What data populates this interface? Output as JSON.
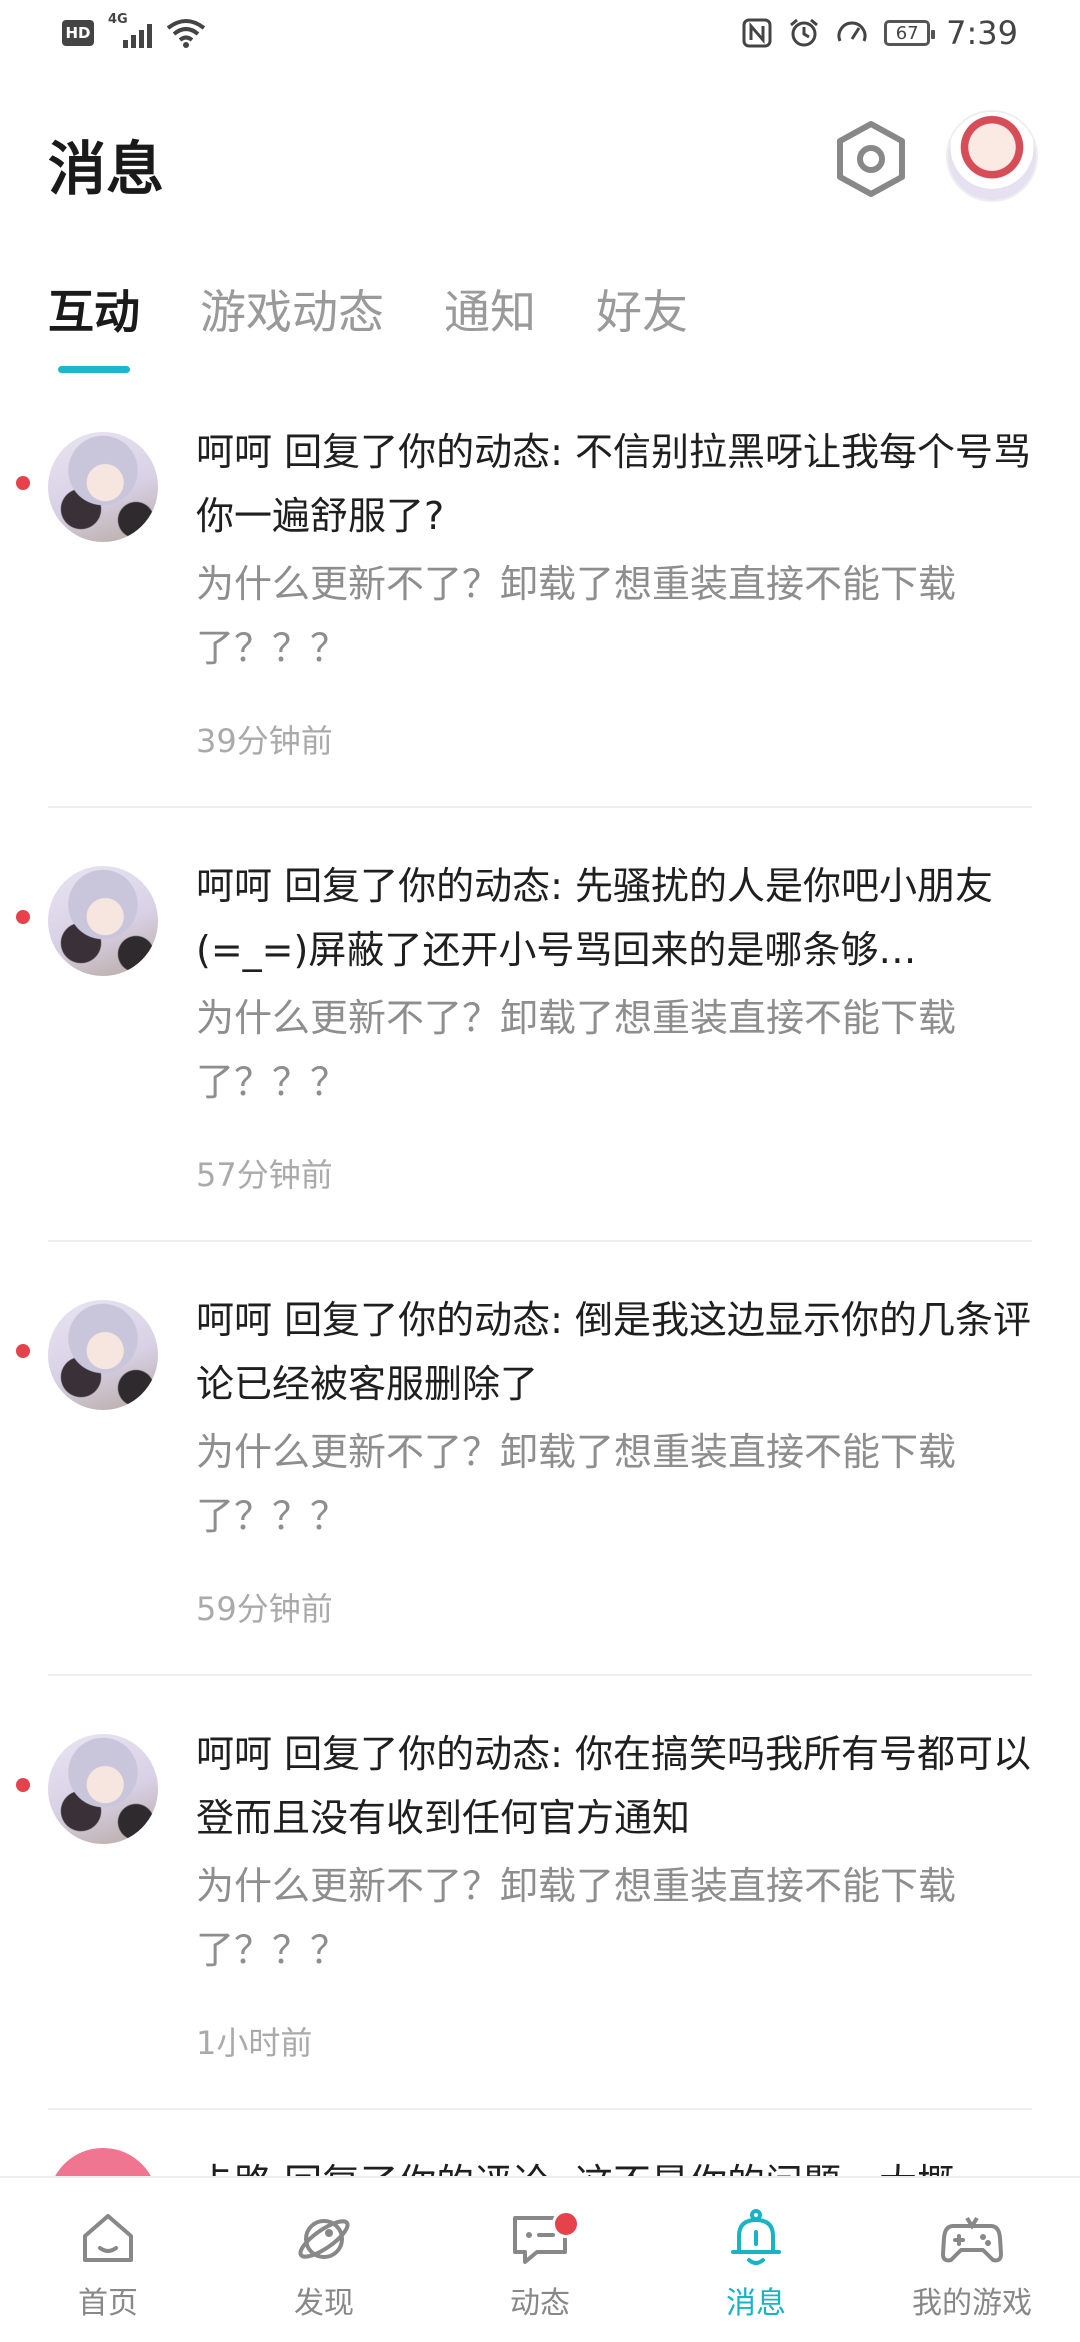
{
  "status_bar": {
    "hd": "HD",
    "network": "4G",
    "battery": "67",
    "time": "7:39"
  },
  "header": {
    "title": "消息"
  },
  "tabs": [
    {
      "label": "互动",
      "active": true
    },
    {
      "label": "游戏动态",
      "active": false
    },
    {
      "label": "通知",
      "active": false
    },
    {
      "label": "好友",
      "active": false
    }
  ],
  "messages": [
    {
      "title": "呵呵 回复了你的动态: 不信别拉黑呀让我每个号骂你一遍舒服了?",
      "quote": "为什么更新不了？卸载了想重装直接不能下载了？？？",
      "time": "39分钟前",
      "unread": true
    },
    {
      "title": "呵呵 回复了你的动态: 先骚扰的人是你吧小朋友(=_=)屏蔽了还开小号骂回来的是哪条够…",
      "quote": "为什么更新不了？卸载了想重装直接不能下载了？？？",
      "time": "57分钟前",
      "unread": true
    },
    {
      "title": "呵呵 回复了你的动态: 倒是我这边显示你的几条评论已经被客服删除了",
      "quote": "为什么更新不了？卸载了想重装直接不能下载了？？？",
      "time": "59分钟前",
      "unread": true
    },
    {
      "title": "呵呵 回复了你的动态: 你在搞笑吗我所有号都可以登而且没有收到任何官方通知",
      "quote": "为什么更新不了？卸载了想重装直接不能下载了？？？",
      "time": "1小时前",
      "unread": true
    }
  ],
  "partial_item": {
    "title": "卡路 回复了你的评论: 这不是你的问题，大概"
  },
  "bottom_nav": [
    {
      "label": "首页",
      "icon": "home-icon",
      "active": false
    },
    {
      "label": "发现",
      "icon": "planet-icon",
      "active": false
    },
    {
      "label": "动态",
      "icon": "chat-icon",
      "active": false,
      "badge": true
    },
    {
      "label": "消息",
      "icon": "bell-icon",
      "active": true
    },
    {
      "label": "我的游戏",
      "icon": "gamepad-icon",
      "active": false
    }
  ],
  "colors": {
    "accent": "#17b4c6",
    "unread_dot": "#e6424b"
  }
}
